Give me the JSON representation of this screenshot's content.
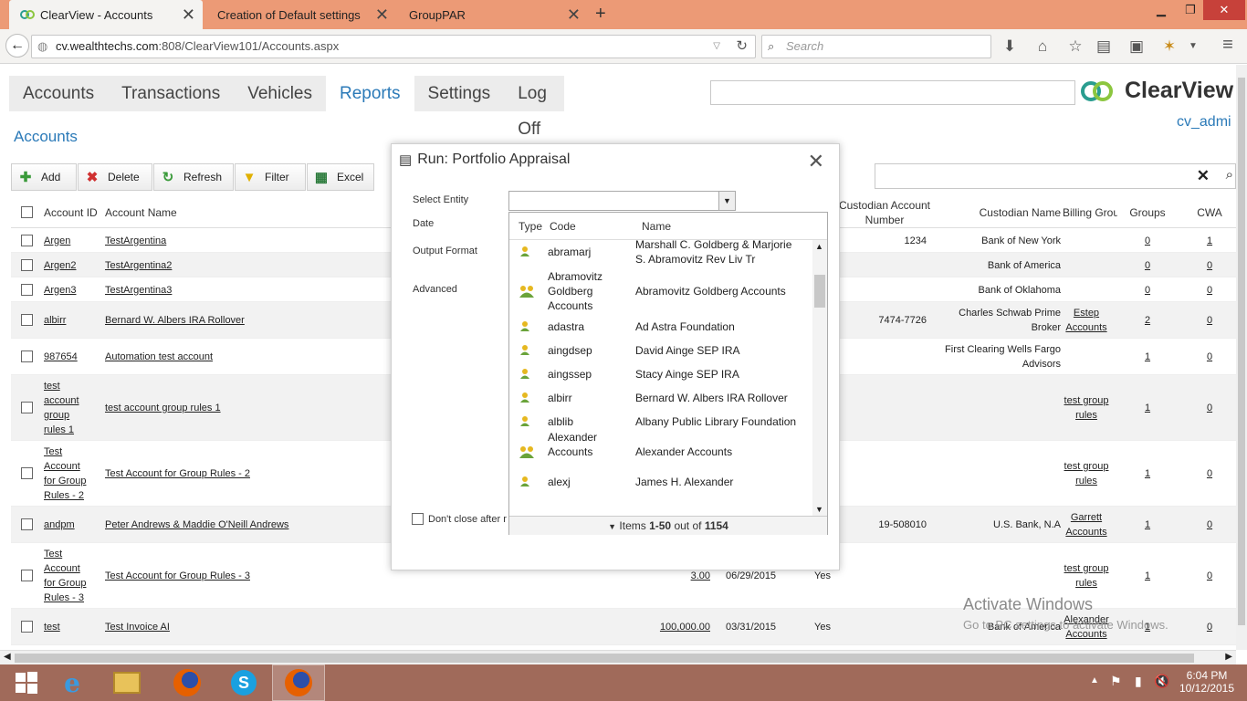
{
  "browser": {
    "tabs": [
      {
        "title": "ClearView - Accounts"
      },
      {
        "title": "Creation of Default settings"
      },
      {
        "title": "GroupPAR"
      }
    ],
    "url_host": "cv.wealthtechs.com",
    "url_path": ":808/ClearView101/Accounts.aspx",
    "search_placeholder": "Search"
  },
  "app": {
    "menu": [
      "Accounts",
      "Transactions",
      "Vehicles",
      "Reports",
      "Settings",
      "Log Off"
    ],
    "active_menu": "Reports",
    "logo_text": "ClearView",
    "user": "cv_admi",
    "breadcrumb": "Accounts",
    "toolbar": [
      "Add",
      "Delete",
      "Refresh",
      "Filter",
      "Excel"
    ]
  },
  "table": {
    "headers": {
      "account_id": "Account ID",
      "account_name": "Account Name",
      "custodian_account": "Custodian Account Number",
      "custodian_name": "Custodian Name",
      "billing_group": "Billing Group",
      "groups": "Groups",
      "cwa": "CWA"
    },
    "rows": [
      {
        "id": "Argen",
        "name": "TestArgentina",
        "amount": "",
        "date": "",
        "flag": "",
        "cust_acct": "1234",
        "cust_name": "Bank of New York",
        "billing": "",
        "groups": "0",
        "cwa": "1"
      },
      {
        "id": "Argen2",
        "name": "TestArgentina2",
        "amount": "",
        "date": "",
        "flag": "",
        "cust_acct": "",
        "cust_name": "Bank of America",
        "billing": "",
        "groups": "0",
        "cwa": "0"
      },
      {
        "id": "Argen3",
        "name": "TestArgentina3",
        "amount": "",
        "date": "",
        "flag": "",
        "cust_acct": "",
        "cust_name": "Bank of Oklahoma",
        "billing": "",
        "groups": "0",
        "cwa": "0"
      },
      {
        "id": "albirr",
        "name": "Bernard W. Albers IRA Rollover",
        "amount": "",
        "date": "",
        "flag": "",
        "cust_acct": "7474-7726",
        "cust_name": "Charles Schwab Prime Broker",
        "billing": "Estep Accounts",
        "groups": "2",
        "cwa": "0"
      },
      {
        "id": "987654",
        "name": "Automation test account",
        "amount": "",
        "date": "",
        "flag": "",
        "cust_acct": "",
        "cust_name": "First Clearing Wells Fargo Advisors",
        "billing": "",
        "groups": "1",
        "cwa": "0"
      },
      {
        "id": "test account group rules 1",
        "name": "test account group rules 1",
        "amount": "",
        "date": "",
        "flag": "",
        "cust_acct": "",
        "cust_name": "",
        "billing": "test group rules",
        "groups": "1",
        "cwa": "0"
      },
      {
        "id": "Test Account for Group Rules - 2",
        "name": "Test Account for Group Rules - 2",
        "amount": "",
        "date": "",
        "flag": "",
        "cust_acct": "",
        "cust_name": "",
        "billing": "test group rules",
        "groups": "1",
        "cwa": "0"
      },
      {
        "id": "andpm",
        "name": "Peter Andrews & Maddie O'Neill Andrews",
        "amount": "",
        "date": "",
        "flag": "",
        "cust_acct": "19-508010",
        "cust_name": "U.S. Bank, N.A",
        "billing": "Garrett Accounts",
        "groups": "1",
        "cwa": "0"
      },
      {
        "id": "Test Account for Group Rules - 3",
        "name": "Test Account for Group Rules - 3",
        "amount": "3.00",
        "date": "06/29/2015",
        "flag": "Yes",
        "cust_acct": "",
        "cust_name": "",
        "billing": "test group rules",
        "groups": "1",
        "cwa": "0"
      },
      {
        "id": "test",
        "name": "Test Invoice AI",
        "amount": "100,000.00",
        "date": "03/31/2015",
        "flag": "Yes",
        "cust_acct": "",
        "cust_name": "Bank of America",
        "billing": "Alexander Accounts",
        "groups": "1",
        "cwa": "0"
      }
    ]
  },
  "dialog": {
    "title": "Run: Portfolio Appraisal",
    "labels": {
      "entity": "Select Entity",
      "date": "Date",
      "format": "Output Format",
      "advanced": "Advanced",
      "dont_close": "Don't close after r"
    },
    "dropdown_headers": {
      "type": "Type",
      "code": "Code",
      "name": "Name"
    },
    "entities": [
      {
        "kind": "single",
        "code": "abramarj",
        "name": "Marshall C. Goldberg & Marjorie S. Abramovitz Rev Liv Tr"
      },
      {
        "kind": "group",
        "code": "Abramovitz Goldberg Accounts",
        "name": "Abramovitz Goldberg Accounts"
      },
      {
        "kind": "single",
        "code": "adastra",
        "name": "Ad Astra Foundation"
      },
      {
        "kind": "single",
        "code": "aingdsep",
        "name": "David Ainge SEP IRA"
      },
      {
        "kind": "single",
        "code": "aingssep",
        "name": "Stacy Ainge SEP IRA"
      },
      {
        "kind": "single",
        "code": "albirr",
        "name": "Bernard W. Albers IRA Rollover"
      },
      {
        "kind": "single",
        "code": "alblib",
        "name": "Albany Public Library Foundation"
      },
      {
        "kind": "group",
        "code": "Alexander Accounts",
        "name": "Alexander Accounts"
      },
      {
        "kind": "single",
        "code": "alexj",
        "name": "James H. Alexander"
      }
    ],
    "footer_prefix": "Items ",
    "footer_range": "1-50",
    "footer_mid": " out of ",
    "footer_total": "1154"
  },
  "os": {
    "watermark_title": "Activate Windows",
    "watermark_sub": "Go to PC settings to activate Windows.",
    "time": "6:04 PM",
    "date": "10/12/2015"
  },
  "colors": {
    "link_blue": "#2b7ab8",
    "tabbar": "#ec9a76",
    "taskbar": "#a06a5a"
  }
}
